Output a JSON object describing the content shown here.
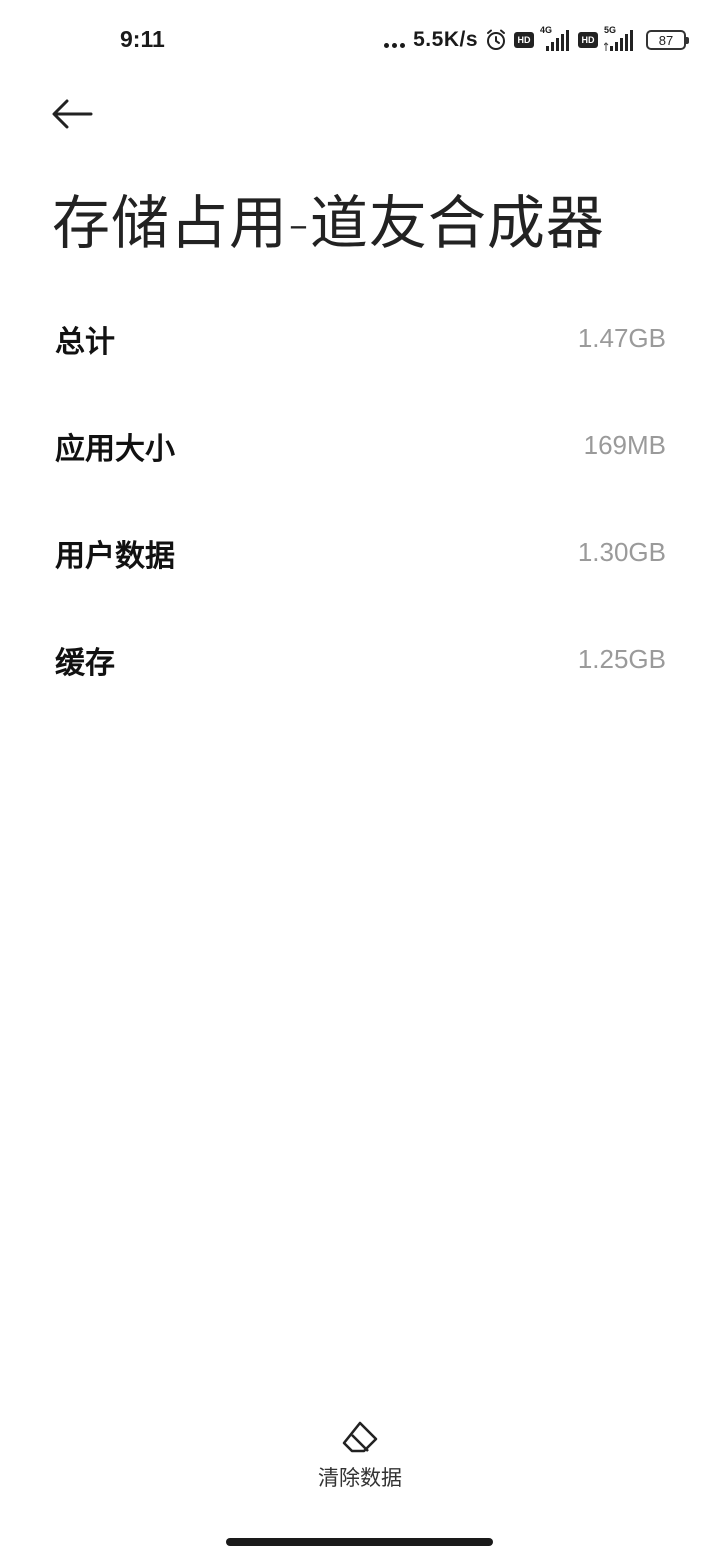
{
  "status_bar": {
    "time": "9:11",
    "net_speed": "5.5K/s",
    "sim1_badge": "HD",
    "sim1_network": "4G",
    "sim2_badge": "HD",
    "sim2_network": "5G",
    "battery": "87"
  },
  "header": {
    "title": "存储占用-道友合成器"
  },
  "storage": {
    "items": [
      {
        "label": "总计",
        "value": "1.47GB"
      },
      {
        "label": "应用大小",
        "value": "169MB"
      },
      {
        "label": "用户数据",
        "value": "1.30GB"
      },
      {
        "label": "缓存",
        "value": "1.25GB"
      }
    ]
  },
  "actions": {
    "clear_data_label": "清除数据"
  },
  "icons": {
    "back": "arrow-left-icon",
    "clear": "eraser-icon",
    "alarm": "alarm-icon",
    "signal": "signal-icon",
    "battery": "battery-icon"
  }
}
